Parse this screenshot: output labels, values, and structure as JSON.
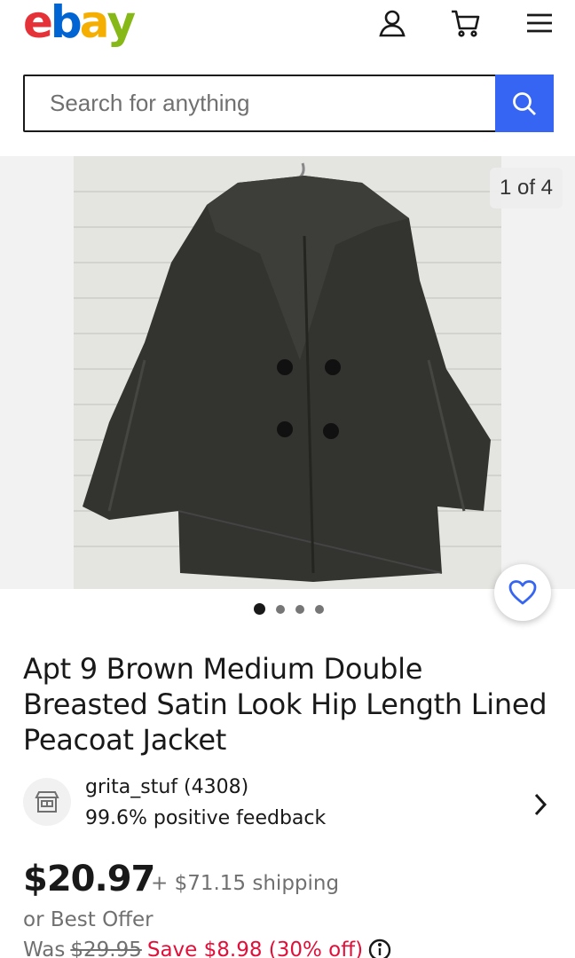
{
  "header": {
    "logo": {
      "letters": [
        "e",
        "b",
        "a",
        "y"
      ],
      "colors": [
        "#e53238",
        "#0064d2",
        "#f5af02",
        "#86b817"
      ]
    },
    "icons": [
      "user-icon",
      "cart-icon",
      "menu-icon"
    ]
  },
  "search": {
    "placeholder": "Search for anything",
    "value": "",
    "accent": "#3665f3"
  },
  "gallery": {
    "counter": "1 of 4",
    "total": 4,
    "active_index": 0
  },
  "listing": {
    "title": "Apt 9 Brown Medium Double Breasted Satin Look Hip Length Lined Peacoat Jacket",
    "seller": {
      "name": "grita_stuf (4308)",
      "feedback": "99.6% positive feedback"
    },
    "price": "$20.97",
    "shipping": "+ $71.15 shipping",
    "best_offer": "or Best Offer",
    "was_label": "Was",
    "was_price": "$29.95",
    "save": "Save $8.98 (30% off)",
    "save_color": "#e0103a"
  }
}
